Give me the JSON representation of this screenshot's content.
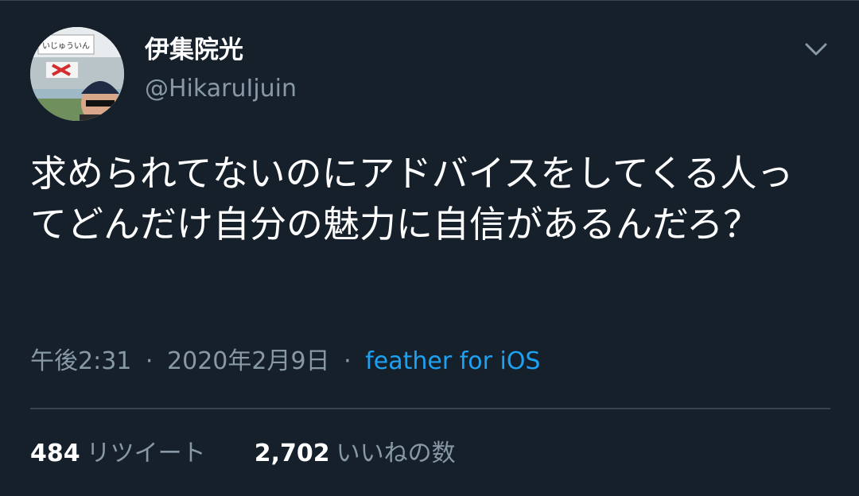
{
  "user": {
    "display_name": "伊集院光",
    "handle": "@HikaruIjuin",
    "avatar_icon": "avatar-photo",
    "avatar_sign_text": "いじゅういん"
  },
  "menu": {
    "icon": "chevron-down-icon"
  },
  "tweet": {
    "text": "求められてないのにアドバイスをしてくる人ってどんだけ自分の魅力に自信があるんだろ？"
  },
  "meta": {
    "time": "午後2:31",
    "separator": "·",
    "date": "2020年2月9日",
    "source": "feather for iOS"
  },
  "stats": {
    "retweets_count": "484",
    "retweets_label": "リツイート",
    "likes_count": "2,702",
    "likes_label": "いいねの数"
  },
  "colors": {
    "background": "#15202b",
    "primary_text": "#ffffff",
    "secondary_text": "#8899a6",
    "link": "#1da1f2",
    "divider": "#38444d"
  }
}
